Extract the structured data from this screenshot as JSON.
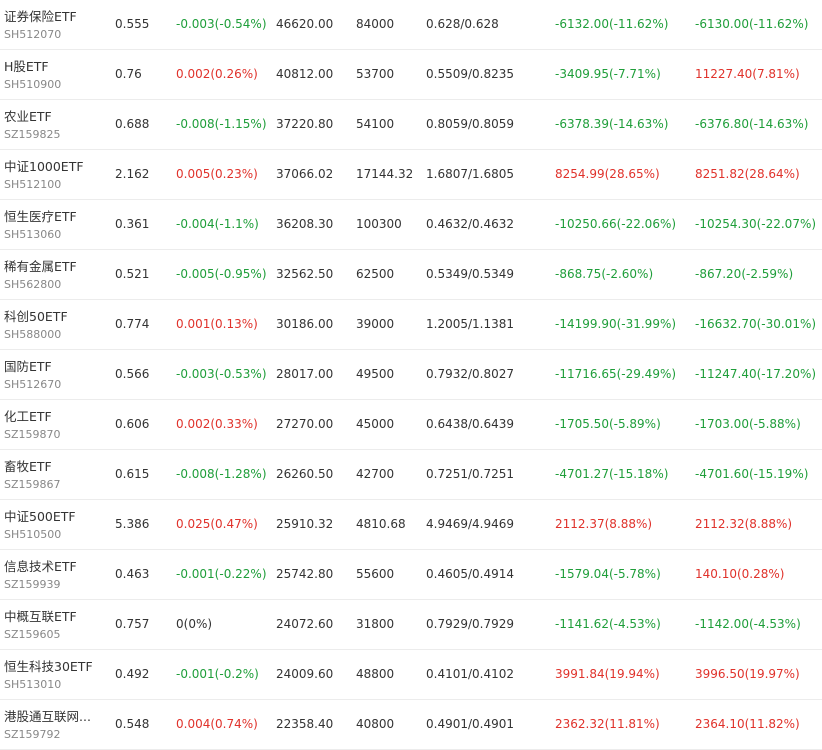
{
  "rows": [
    {
      "name": "证券保险ETF",
      "code": "SH512070",
      "price": "0.555",
      "change": "-0.003(-0.54%)",
      "change_dir": "down",
      "value": "46620.00",
      "shares": "84000",
      "cost": "0.628/0.628",
      "pnl1": "-6132.00(-11.62%)",
      "pnl1_dir": "down",
      "pnl2": "-6130.00(-11.62%)",
      "pnl2_dir": "down"
    },
    {
      "name": "H股ETF",
      "code": "SH510900",
      "price": "0.76",
      "change": "0.002(0.26%)",
      "change_dir": "up",
      "value": "40812.00",
      "shares": "53700",
      "cost": "0.5509/0.8235",
      "pnl1": "-3409.95(-7.71%)",
      "pnl1_dir": "down",
      "pnl2": "11227.40(7.81%)",
      "pnl2_dir": "up"
    },
    {
      "name": "农业ETF",
      "code": "SZ159825",
      "price": "0.688",
      "change": "-0.008(-1.15%)",
      "change_dir": "down",
      "value": "37220.80",
      "shares": "54100",
      "cost": "0.8059/0.8059",
      "pnl1": "-6378.39(-14.63%)",
      "pnl1_dir": "down",
      "pnl2": "-6376.80(-14.63%)",
      "pnl2_dir": "down"
    },
    {
      "name": "中证1000ETF",
      "code": "SH512100",
      "price": "2.162",
      "change": "0.005(0.23%)",
      "change_dir": "up",
      "value": "37066.02",
      "shares": "17144.32",
      "cost": "1.6807/1.6805",
      "pnl1": "8254.99(28.65%)",
      "pnl1_dir": "up",
      "pnl2": "8251.82(28.64%)",
      "pnl2_dir": "up"
    },
    {
      "name": "恒生医疗ETF",
      "code": "SH513060",
      "price": "0.361",
      "change": "-0.004(-1.1%)",
      "change_dir": "down",
      "value": "36208.30",
      "shares": "100300",
      "cost": "0.4632/0.4632",
      "pnl1": "-10250.66(-22.06%)",
      "pnl1_dir": "down",
      "pnl2": "-10254.30(-22.07%)",
      "pnl2_dir": "down"
    },
    {
      "name": "稀有金属ETF",
      "code": "SH562800",
      "price": "0.521",
      "change": "-0.005(-0.95%)",
      "change_dir": "down",
      "value": "32562.50",
      "shares": "62500",
      "cost": "0.5349/0.5349",
      "pnl1": "-868.75(-2.60%)",
      "pnl1_dir": "down",
      "pnl2": "-867.20(-2.59%)",
      "pnl2_dir": "down"
    },
    {
      "name": "科创50ETF",
      "code": "SH588000",
      "price": "0.774",
      "change": "0.001(0.13%)",
      "change_dir": "up",
      "value": "30186.00",
      "shares": "39000",
      "cost": "1.2005/1.1381",
      "pnl1": "-14199.90(-31.99%)",
      "pnl1_dir": "down",
      "pnl2": "-16632.70(-30.01%)",
      "pnl2_dir": "down"
    },
    {
      "name": "国防ETF",
      "code": "SH512670",
      "price": "0.566",
      "change": "-0.003(-0.53%)",
      "change_dir": "down",
      "value": "28017.00",
      "shares": "49500",
      "cost": "0.7932/0.8027",
      "pnl1": "-11716.65(-29.49%)",
      "pnl1_dir": "down",
      "pnl2": "-11247.40(-17.20%)",
      "pnl2_dir": "down"
    },
    {
      "name": "化工ETF",
      "code": "SZ159870",
      "price": "0.606",
      "change": "0.002(0.33%)",
      "change_dir": "up",
      "value": "27270.00",
      "shares": "45000",
      "cost": "0.6438/0.6439",
      "pnl1": "-1705.50(-5.89%)",
      "pnl1_dir": "down",
      "pnl2": "-1703.00(-5.88%)",
      "pnl2_dir": "down"
    },
    {
      "name": "畜牧ETF",
      "code": "SZ159867",
      "price": "0.615",
      "change": "-0.008(-1.28%)",
      "change_dir": "down",
      "value": "26260.50",
      "shares": "42700",
      "cost": "0.7251/0.7251",
      "pnl1": "-4701.27(-15.18%)",
      "pnl1_dir": "down",
      "pnl2": "-4701.60(-15.19%)",
      "pnl2_dir": "down"
    },
    {
      "name": "中证500ETF",
      "code": "SH510500",
      "price": "5.386",
      "change": "0.025(0.47%)",
      "change_dir": "up",
      "value": "25910.32",
      "shares": "4810.68",
      "cost": "4.9469/4.9469",
      "pnl1": "2112.37(8.88%)",
      "pnl1_dir": "up",
      "pnl2": "2112.32(8.88%)",
      "pnl2_dir": "up"
    },
    {
      "name": "信息技术ETF",
      "code": "SZ159939",
      "price": "0.463",
      "change": "-0.001(-0.22%)",
      "change_dir": "down",
      "value": "25742.80",
      "shares": "55600",
      "cost": "0.4605/0.4914",
      "pnl1": "-1579.04(-5.78%)",
      "pnl1_dir": "down",
      "pnl2": "140.10(0.28%)",
      "pnl2_dir": "up"
    },
    {
      "name": "中概互联ETF",
      "code": "SZ159605",
      "price": "0.757",
      "change": "0(0%)",
      "change_dir": "flat",
      "value": "24072.60",
      "shares": "31800",
      "cost": "0.7929/0.7929",
      "pnl1": "-1141.62(-4.53%)",
      "pnl1_dir": "down",
      "pnl2": "-1142.00(-4.53%)",
      "pnl2_dir": "down"
    },
    {
      "name": "恒生科技30ETF",
      "code": "SH513010",
      "price": "0.492",
      "change": "-0.001(-0.2%)",
      "change_dir": "down",
      "value": "24009.60",
      "shares": "48800",
      "cost": "0.4101/0.4102",
      "pnl1": "3991.84(19.94%)",
      "pnl1_dir": "up",
      "pnl2": "3996.50(19.97%)",
      "pnl2_dir": "up"
    },
    {
      "name": "港股通互联网...",
      "code": "SZ159792",
      "price": "0.548",
      "change": "0.004(0.74%)",
      "change_dir": "up",
      "value": "22358.40",
      "shares": "40800",
      "cost": "0.4901/0.4901",
      "pnl1": "2362.32(11.81%)",
      "pnl1_dir": "up",
      "pnl2": "2364.10(11.82%)",
      "pnl2_dir": "up"
    }
  ],
  "colors": {
    "up": "#e0322b",
    "down": "#1f9e3a",
    "flat": "#333333"
  }
}
